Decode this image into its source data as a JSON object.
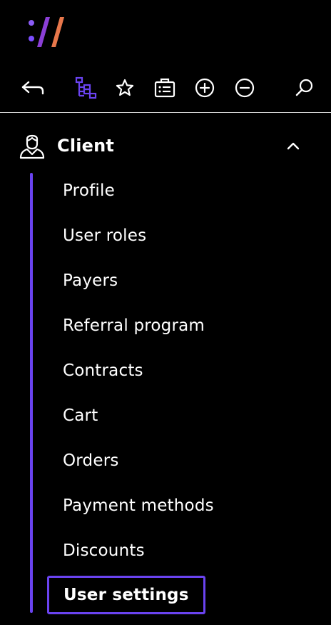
{
  "brand": {
    "logo_name": "brand-logo",
    "accent_color": "#6a43f0",
    "slash_color_1": "#8b3fd6",
    "slash_color_2": "#e8774b"
  },
  "toolbar": {
    "icons": [
      "back-arrow-icon",
      "tree-view-icon",
      "favorite-star-icon",
      "briefcase-list-icon",
      "zoom-in-plus-icon",
      "zoom-out-minus-icon",
      "search-icon"
    ]
  },
  "section": {
    "icon": "user-avatar-icon",
    "title": "Client",
    "expanded": true,
    "items": [
      {
        "label": "Profile"
      },
      {
        "label": "User roles"
      },
      {
        "label": "Payers"
      },
      {
        "label": "Referral program"
      },
      {
        "label": "Contracts"
      },
      {
        "label": "Cart"
      },
      {
        "label": "Orders"
      },
      {
        "label": "Payment methods"
      },
      {
        "label": "Discounts"
      },
      {
        "label": "User settings"
      }
    ],
    "active_item": "User settings"
  }
}
